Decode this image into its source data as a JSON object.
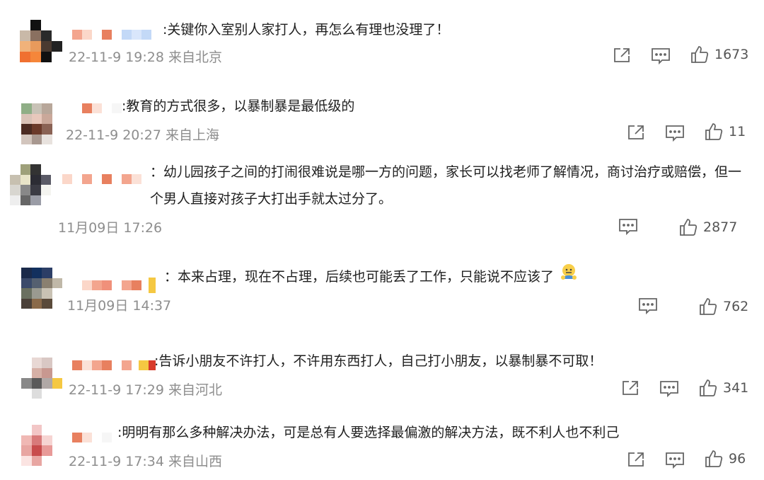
{
  "comments": [
    {
      "text": ":关键你入室别人家打人，再怎么有理也没理了！",
      "meta": "22-11-9 19:28 来自北京",
      "likes": "1673"
    },
    {
      "text": ":教育的方式很多，以暴制暴是最低级的",
      "meta": "22-1​1-9 20:27 来自上海",
      "likes": "11"
    },
    {
      "text": "：幼儿园孩子之间的打闹很难说是哪一方的问题，家长可以找老师了解情况，商讨治疗或赔偿，但一个男人直接对孩子大打出手就太过分了。",
      "meta": "11月09日 17:26",
      "likes": "2877"
    },
    {
      "text": "：本来占理，现在不占理，后续也可能丢了工作，只能说不应该了",
      "meta": "11月09日 14:37",
      "likes": "762"
    },
    {
      "text": ":告诉小朋友不许打人，不许用东西打人，自己打小朋友，以暴制暴不可取！",
      "meta": "22-11-9 17:29 来自河北",
      "likes": "341"
    },
    {
      "text": ":明明有那么多种解决办法，可是总有人要选择最偏激的解决方法，既不利人也不利己",
      "meta": "22-11-9 17:34 来自山西",
      "likes": "96"
    }
  ],
  "icons": {
    "share": "share-icon",
    "comment": "comment-icon",
    "like": "thumbs-up-icon",
    "emoji": "emoji-face-icon"
  }
}
